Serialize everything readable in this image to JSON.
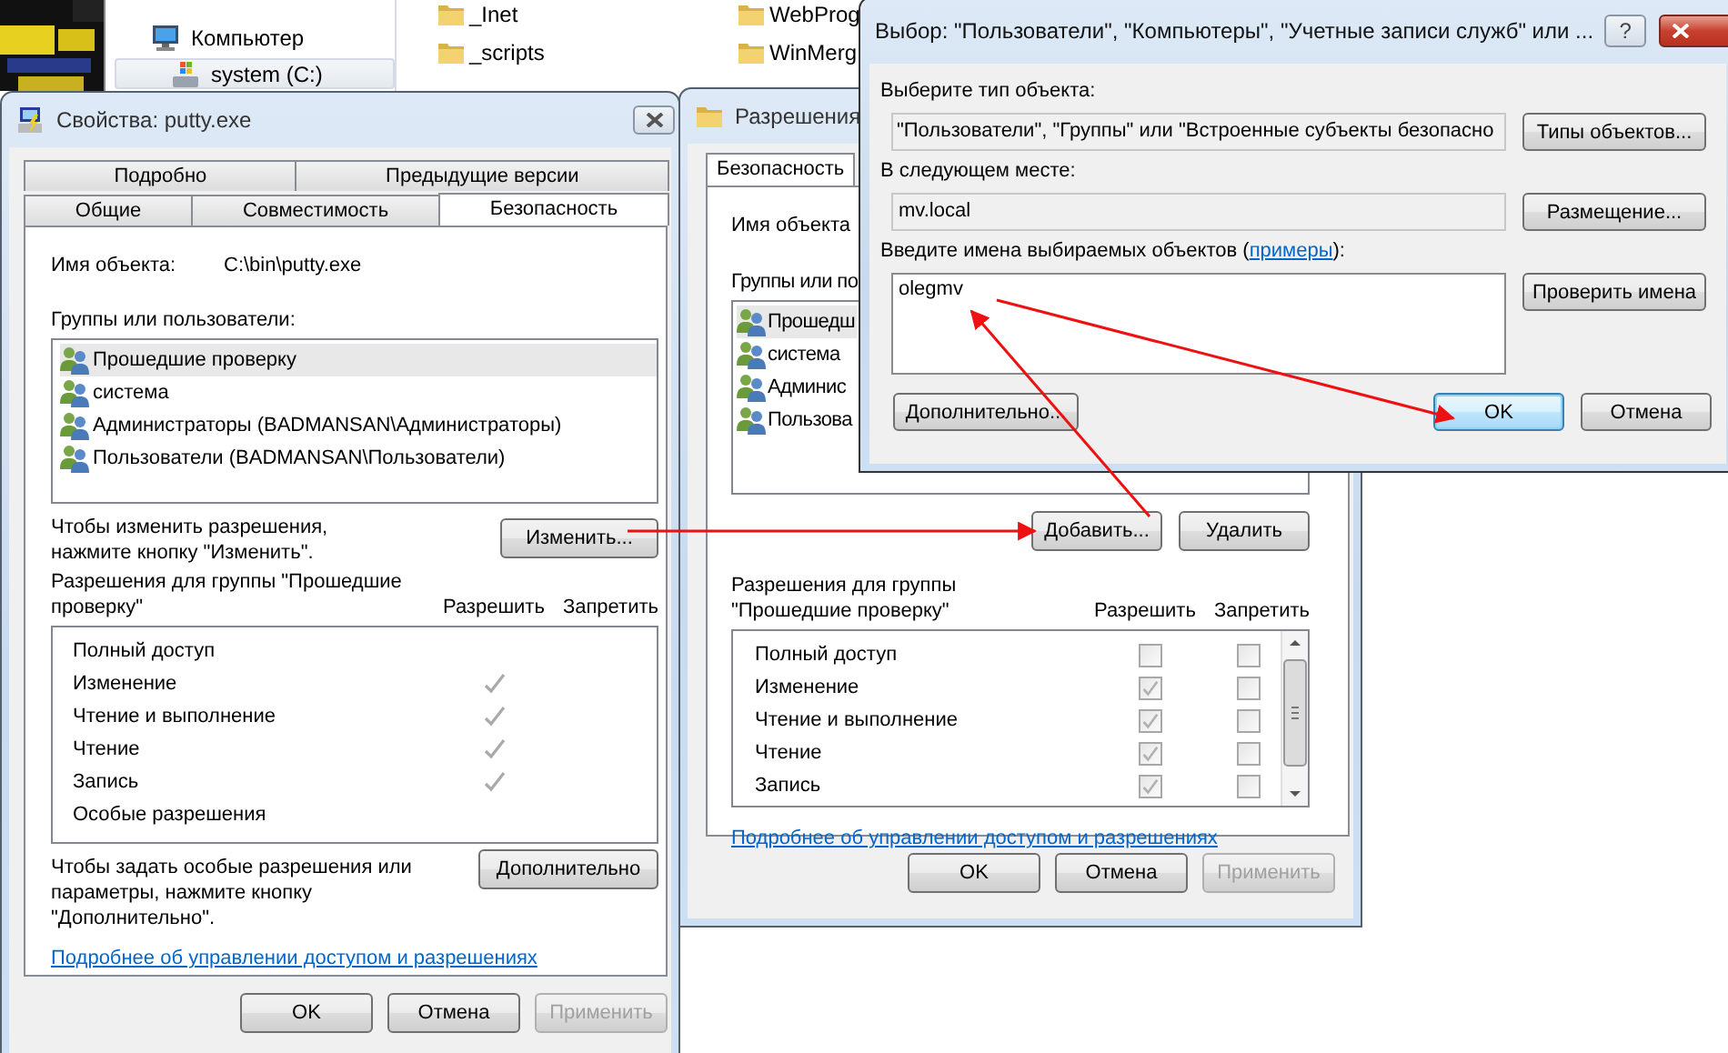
{
  "explorer": {
    "nav_items": [
      {
        "label": "Компьютер",
        "kind": "computer",
        "selected": false
      },
      {
        "label": "system (C:)",
        "kind": "drive",
        "selected": true
      }
    ],
    "file_columns": [
      [
        "_Inet",
        "_scripts"
      ],
      [
        "WebProg",
        "WinMerg"
      ]
    ]
  },
  "properties_window": {
    "title": "Свойства: putty.exe",
    "tab_rows": [
      [
        {
          "label": "Подробно",
          "selected": false
        },
        {
          "label": "Предыдущие версии",
          "selected": false
        }
      ],
      [
        {
          "label": "Общие",
          "selected": false
        },
        {
          "label": "Совместимость",
          "selected": false
        },
        {
          "label": "Безопасность",
          "selected": true
        }
      ]
    ],
    "object_name_label": "Имя объекта:",
    "object_name": "C:\\bin\\putty.exe",
    "groups_label": "Группы или пользователи:",
    "groups": [
      {
        "name": "Прошедшие проверку",
        "selected": true
      },
      {
        "name": "система",
        "selected": false
      },
      {
        "name": "Администраторы (BADMANSAN\\Администраторы)",
        "selected": false
      },
      {
        "name": "Пользователи (BADMANSAN\\Пользователи)",
        "selected": false
      }
    ],
    "change_hint": "Чтобы изменить разрешения,\nнажмите кнопку \"Изменить\".",
    "change_button": "Изменить...",
    "permissions_label": "Разрешения для группы \"Прошедшие\nпроверку\"",
    "allow_header": "Разрешить",
    "deny_header": "Запретить",
    "permissions": [
      {
        "name": "Полный доступ",
        "allow": false,
        "deny": false
      },
      {
        "name": "Изменение",
        "allow": true,
        "deny": false
      },
      {
        "name": "Чтение и выполнение",
        "allow": true,
        "deny": false
      },
      {
        "name": "Чтение",
        "allow": true,
        "deny": false
      },
      {
        "name": "Запись",
        "allow": true,
        "deny": false
      },
      {
        "name": "Особые разрешения",
        "allow": false,
        "deny": false
      }
    ],
    "special_hint": "Чтобы задать особые разрешения или\nпараметры, нажмите кнопку\n\"Дополнительно\".",
    "advanced_button": "Дополнительно",
    "help_link": "Подробнее об управлении доступом и разрешениях",
    "buttons": [
      {
        "label": "OK",
        "disabled": false
      },
      {
        "label": "Отмена",
        "disabled": false
      },
      {
        "label": "Применить",
        "disabled": true
      }
    ]
  },
  "permissions_window": {
    "title": "Разрешения",
    "tab": {
      "label": "Безопасность",
      "selected": true
    },
    "object_name_label": "Имя объекта",
    "groups_label": "Группы или по",
    "groups": [
      {
        "name": "Прошедш",
        "selected": true
      },
      {
        "name": "система",
        "selected": false
      },
      {
        "name": "Админис",
        "selected": false
      },
      {
        "name": "Пользова",
        "selected": false
      }
    ],
    "add_button": "Добавить...",
    "remove_button": "Удалить",
    "permissions_label": "Разрешения для группы\n\"Прошедшие проверку\"",
    "allow_header": "Разрешить",
    "deny_header": "Запретить",
    "permissions": [
      {
        "name": "Полный доступ",
        "allow": false,
        "deny": false
      },
      {
        "name": "Изменение",
        "allow": true,
        "deny": false
      },
      {
        "name": "Чтение и выполнение",
        "allow": true,
        "deny": false
      },
      {
        "name": "Чтение",
        "allow": true,
        "deny": false
      },
      {
        "name": "Запись",
        "allow": true,
        "deny": false
      }
    ],
    "help_link": "Подробнее об управлении доступом и разрешениях",
    "buttons": [
      {
        "label": "OK",
        "disabled": false
      },
      {
        "label": "Отмена",
        "disabled": false
      },
      {
        "label": "Применить",
        "disabled": true
      }
    ]
  },
  "select_dialog": {
    "title": "Выбор: \"Пользователи\", \"Компьютеры\", \"Учетные записи служб\" или ...",
    "help_button": "?",
    "type_label": "Выберите тип объекта:",
    "type_value": "\"Пользователи\", \"Группы\" или \"Встроенные субъекты безопасно",
    "type_button": "Типы объектов...",
    "location_label": "В следующем месте:",
    "location_value": "mv.local",
    "location_button": "Размещение...",
    "names_label": "Введите имена выбираемых объектов (",
    "names_link": "примеры",
    "names_label_end": "):",
    "names_value": "olegmv",
    "check_button": "Проверить имена",
    "advanced_button": "Дополнительно...",
    "buttons": [
      {
        "label": "OK",
        "default": true
      },
      {
        "label": "Отмена",
        "default": false
      }
    ]
  }
}
